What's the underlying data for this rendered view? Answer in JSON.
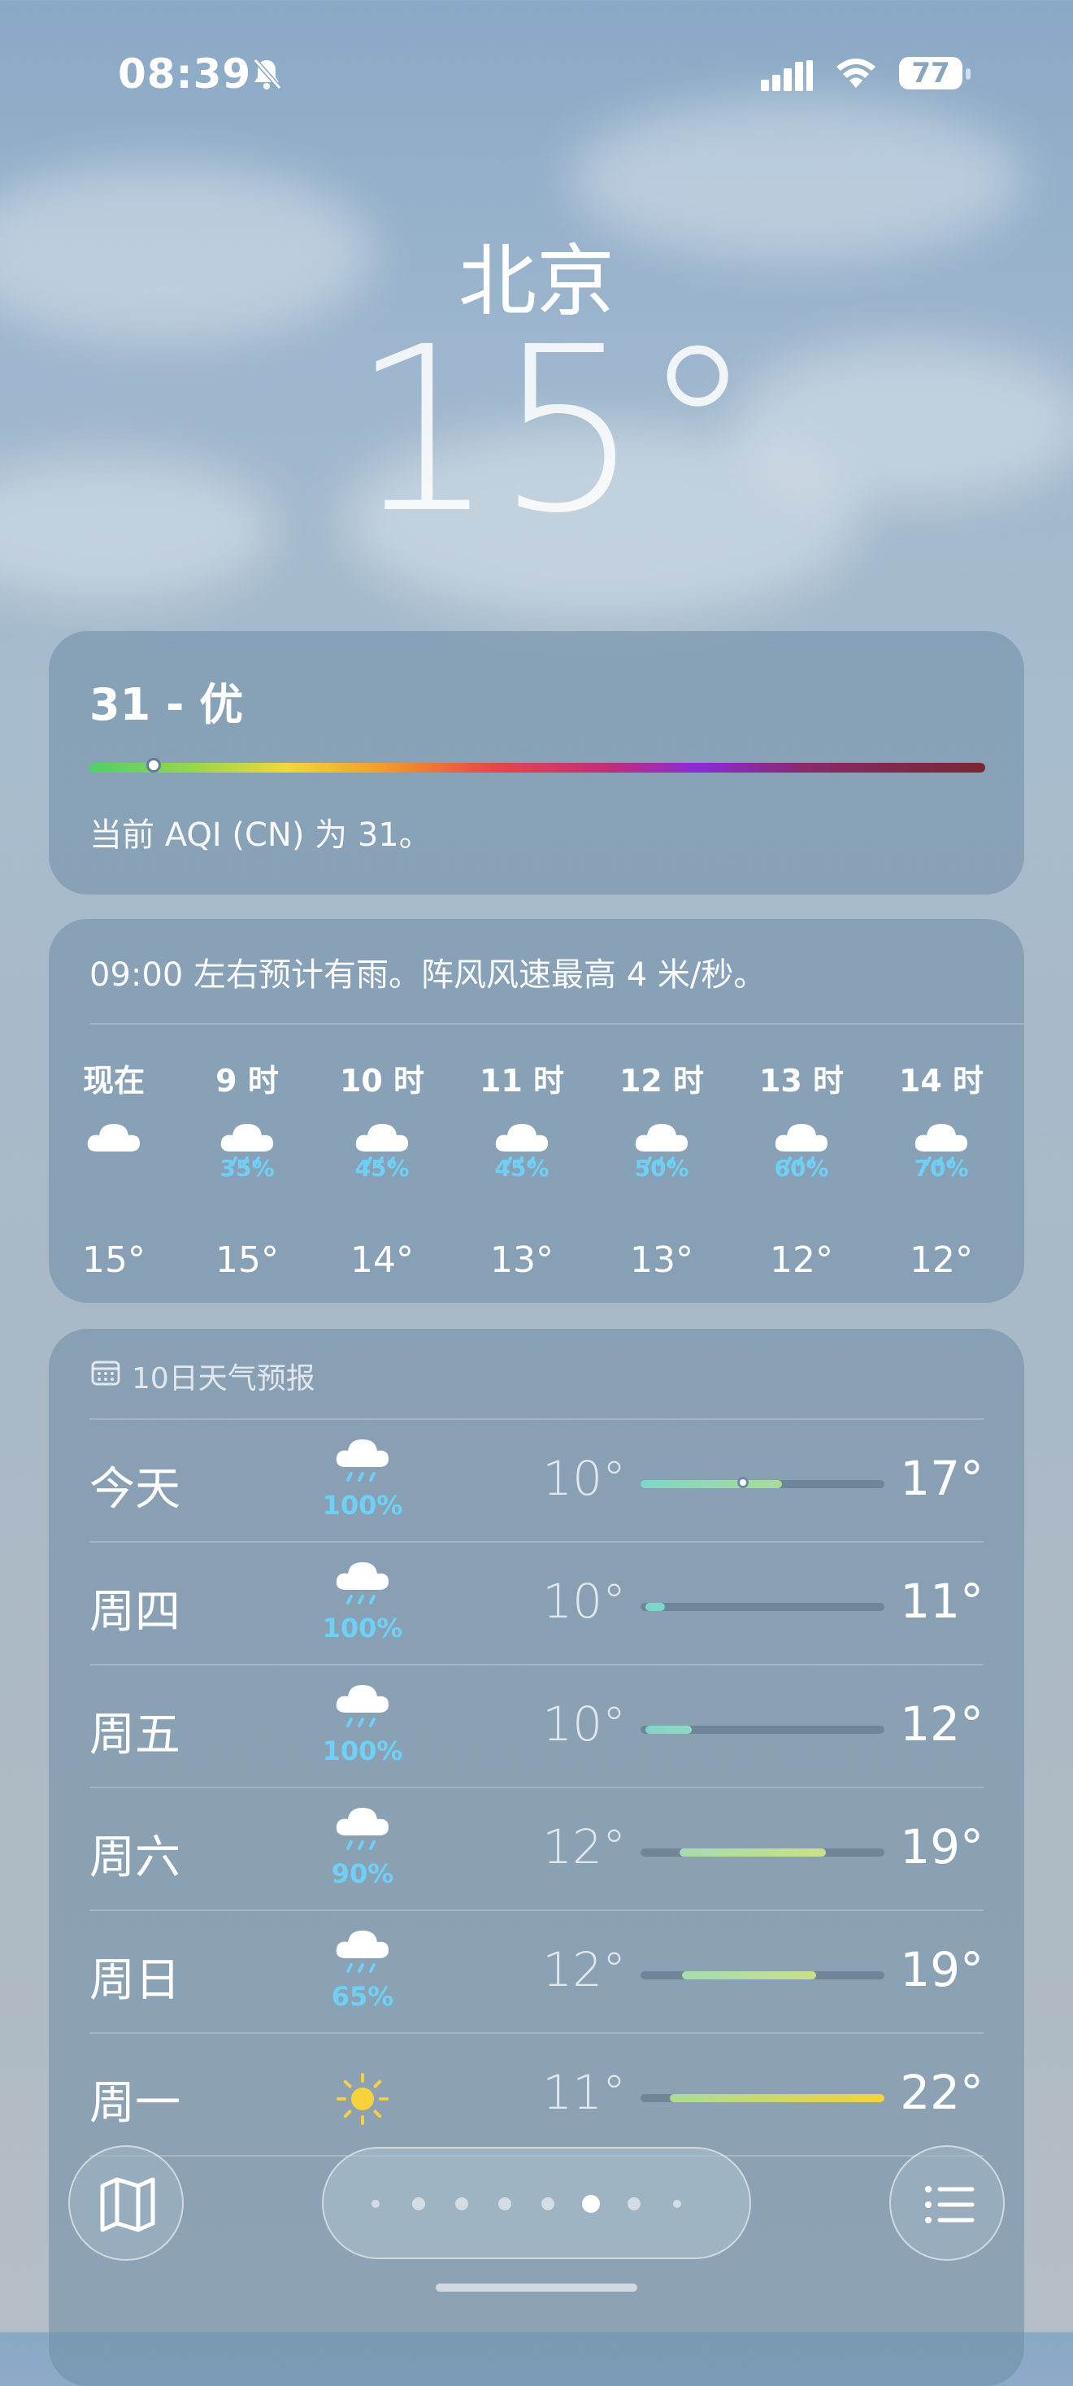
{
  "status_bar": {
    "time": "08:39",
    "battery": "77",
    "icons": [
      "silent-bell-icon",
      "cellular-signal-icon",
      "wifi-icon",
      "battery-icon"
    ]
  },
  "location": {
    "city": "北京",
    "temperature": "15°"
  },
  "aqi": {
    "value_label": "31 - 优",
    "description": "当前 AQI (CN) 为 31。",
    "index": 31
  },
  "hourly": {
    "summary": "09:00 左右预计有雨。阵风风速最高 4 米/秒。",
    "items": [
      {
        "time": "现在",
        "icon": "cloud-icon",
        "precip": "",
        "temp": "15°"
      },
      {
        "time": "9 时",
        "icon": "rain-cloud-icon",
        "precip": "35%",
        "temp": "15°"
      },
      {
        "time": "10 时",
        "icon": "rain-cloud-icon",
        "precip": "45%",
        "temp": "14°"
      },
      {
        "time": "11 时",
        "icon": "rain-cloud-icon",
        "precip": "45%",
        "temp": "13°"
      },
      {
        "time": "12 时",
        "icon": "rain-cloud-icon",
        "precip": "50%",
        "temp": "13°"
      },
      {
        "time": "13 时",
        "icon": "rain-cloud-icon",
        "precip": "60%",
        "temp": "12°"
      },
      {
        "time": "14 时",
        "icon": "rain-cloud-icon",
        "precip": "70%",
        "temp": "12°"
      }
    ]
  },
  "daily": {
    "title": "10日天气预报",
    "days": [
      {
        "day": "今天",
        "icon": "rain-cloud-icon",
        "precip": "100%",
        "low": "10°",
        "high": "17°",
        "range_start": 0.0,
        "range_end": 0.58,
        "current": 0.42,
        "colors": [
          "#7fd6c8",
          "#a9dc9a"
        ]
      },
      {
        "day": "周四",
        "icon": "rain-cloud-icon",
        "precip": "100%",
        "low": "10°",
        "high": "11°",
        "range_start": 0.02,
        "range_end": 0.1,
        "current": null,
        "colors": [
          "#7fd6c8",
          "#7fd6c8"
        ]
      },
      {
        "day": "周五",
        "icon": "rain-cloud-icon",
        "precip": "100%",
        "low": "10°",
        "high": "12°",
        "range_start": 0.02,
        "range_end": 0.21,
        "current": null,
        "colors": [
          "#7fd6c8",
          "#8fd9c0"
        ]
      },
      {
        "day": "周六",
        "icon": "rain-cloud-icon",
        "precip": "90%",
        "low": "12°",
        "high": "19°",
        "range_start": 0.16,
        "range_end": 0.76,
        "current": null,
        "colors": [
          "#a5dcb0",
          "#c9e08a"
        ]
      },
      {
        "day": "周日",
        "icon": "rain-cloud-icon",
        "precip": "65%",
        "low": "12°",
        "high": "19°",
        "range_start": 0.17,
        "range_end": 0.72,
        "current": null,
        "colors": [
          "#a5dcb0",
          "#c9e08a"
        ]
      },
      {
        "day": "周一",
        "icon": "sun-icon",
        "precip": "",
        "low": "11°",
        "high": "22°",
        "range_start": 0.12,
        "range_end": 1.0,
        "current": null,
        "colors": [
          "#a9dc9a",
          "#f5d33a"
        ]
      }
    ]
  },
  "toolbar": {
    "page_count": 8,
    "active_page": 6,
    "icons": [
      "map-icon",
      "list-icon"
    ]
  }
}
